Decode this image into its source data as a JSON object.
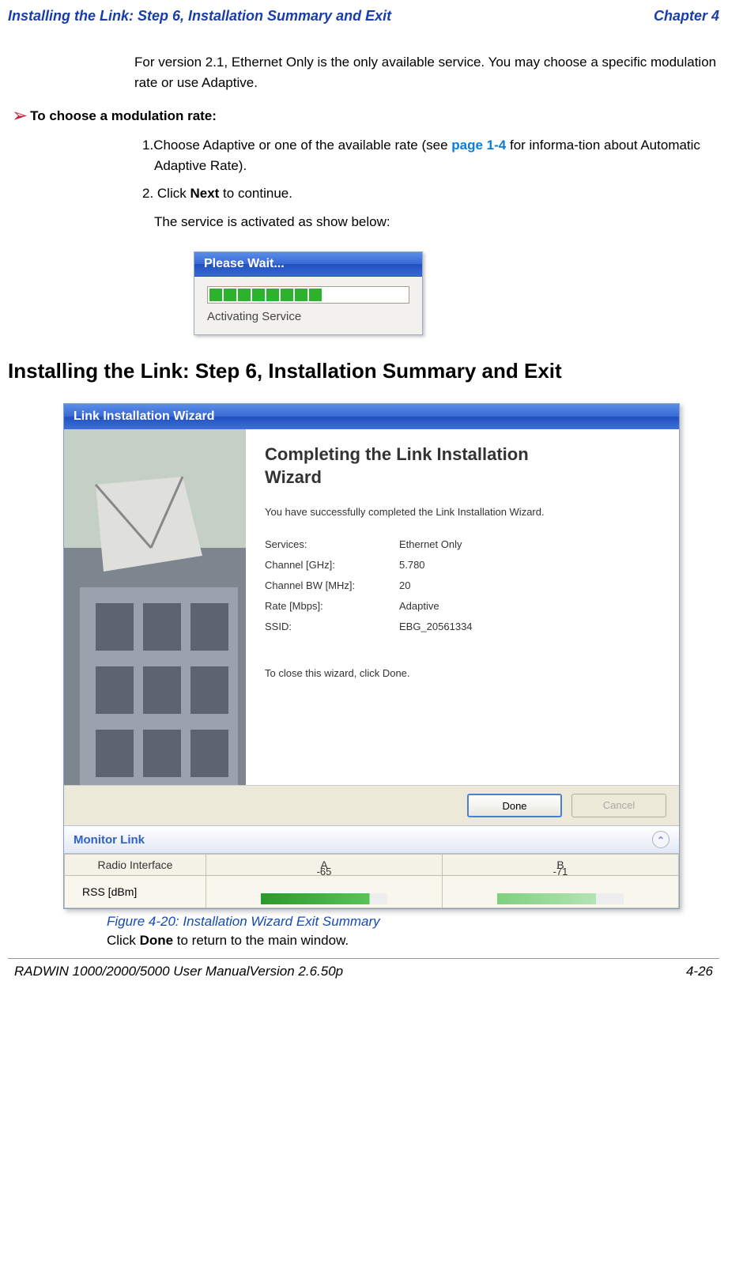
{
  "header": {
    "left": "Installing the Link: Step 6, Installation Summary and Exit",
    "right": "Chapter 4"
  },
  "intro": "For version 2.1, Ethernet Only is the only available service. You may choose a specific modulation rate or use Adaptive.",
  "procedure": {
    "title": "To choose a modulation rate:",
    "step1_pre": "1.Choose Adaptive or one of the available rate (see ",
    "step1_link": "page 1-4",
    "step1_post": " for informa-tion about Automatic Adaptive Rate).",
    "step2_pre": "2. Click ",
    "step2_bold": "Next",
    "step2_post": " to continue.",
    "step2_sub": "The service is activated as show below:"
  },
  "wait_dialog": {
    "title": "Please Wait...",
    "label": "Activating Service"
  },
  "section_title": "Installing the Link: Step 6, Installation Summary and Exit",
  "wizard": {
    "titlebar": "Link Installation Wizard",
    "heading_line1": "Completing the Link Installation",
    "heading_line2": "Wizard",
    "intro_text": "You have successfully completed the Link Installation  Wizard.",
    "rows": [
      {
        "key": "Services:",
        "val": "Ethernet Only"
      },
      {
        "key": "Channel [GHz]:",
        "val": "5.780"
      },
      {
        "key": "Channel BW [MHz]:",
        "val": "20"
      },
      {
        "key": "Rate [Mbps]:",
        "val": "Adaptive"
      },
      {
        "key": "SSID:",
        "val": "EBG_20561334"
      }
    ],
    "close_text": "To close this wizard, click Done.",
    "btn_done": "Done",
    "btn_cancel": "Cancel"
  },
  "monitor": {
    "title": "Monitor Link",
    "col_iface": "Radio Interface",
    "col_a": "A",
    "col_b": "B",
    "row_label": "RSS [dBm]",
    "val_a": "-65",
    "val_b": "-71"
  },
  "figure": {
    "caption": "Figure 4-20: Installation Wizard Exit Summary",
    "note_pre": "Click ",
    "note_bold": "Done",
    "note_post": " to return to the main window."
  },
  "footer": {
    "left": "RADWIN 1000/2000/5000 User ManualVersion  2.6.50p",
    "right": "4-26"
  }
}
